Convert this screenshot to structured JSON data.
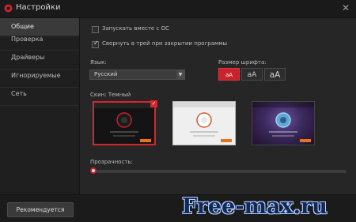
{
  "window": {
    "title": "Настройки"
  },
  "sidebar": {
    "items": [
      {
        "label": "Общие"
      },
      {
        "label": "Проверка"
      },
      {
        "label": "Драйверы"
      },
      {
        "label": "Игнорируемые"
      },
      {
        "label": "Сеть"
      }
    ]
  },
  "general": {
    "startup_label": "Запускать вместе с ОС",
    "startup_checked": false,
    "tray_label": "Свернуть в трей при закрытии программы",
    "tray_checked": true,
    "language_label": "Язык:",
    "language_value": "Русский",
    "font_size_label": "Размер шрифта:",
    "font_sizes": [
      {
        "label": "aA"
      },
      {
        "label": "aA"
      },
      {
        "label": "aA"
      }
    ],
    "font_size_selected": 0,
    "skin_label": "Скин: Темный",
    "skin_selected": 0,
    "opacity_label": "Прозрачность:",
    "opacity_value": 0
  },
  "footer": {
    "recommend_label": "Рекомендуется"
  },
  "watermark": {
    "text": "Free-max.ru"
  },
  "colors": {
    "accent": "#c8222a",
    "background": "#262626",
    "sidebar": "#1f1f1f"
  }
}
